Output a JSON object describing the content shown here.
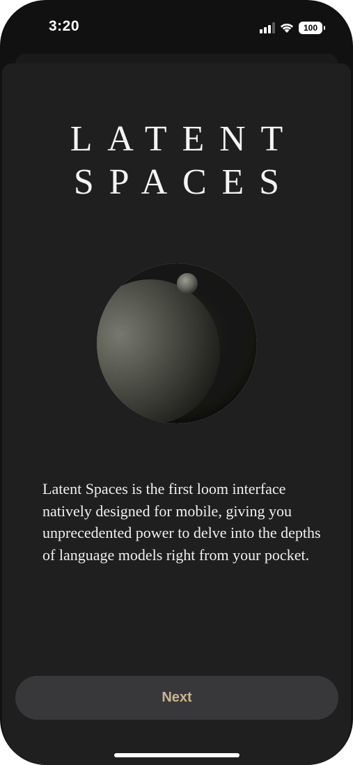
{
  "status_bar": {
    "time": "3:20",
    "battery_level": "100",
    "icons": [
      "signal-icon",
      "wifi-icon",
      "battery-icon"
    ]
  },
  "onboarding": {
    "title_line_1": "LATENT",
    "title_line_2": "SPACES",
    "illustration": "moon-illustration",
    "description": "Latent Spaces is the first loom interface natively designed for mobile, giving you unprecedented power to delve into the depths of language models right from your pocket.",
    "next_label": "Next"
  },
  "colors": {
    "background": "#1f1f20",
    "text": "#f0f0ee",
    "button_background": "#38383a",
    "button_text": "#c8b68f"
  }
}
